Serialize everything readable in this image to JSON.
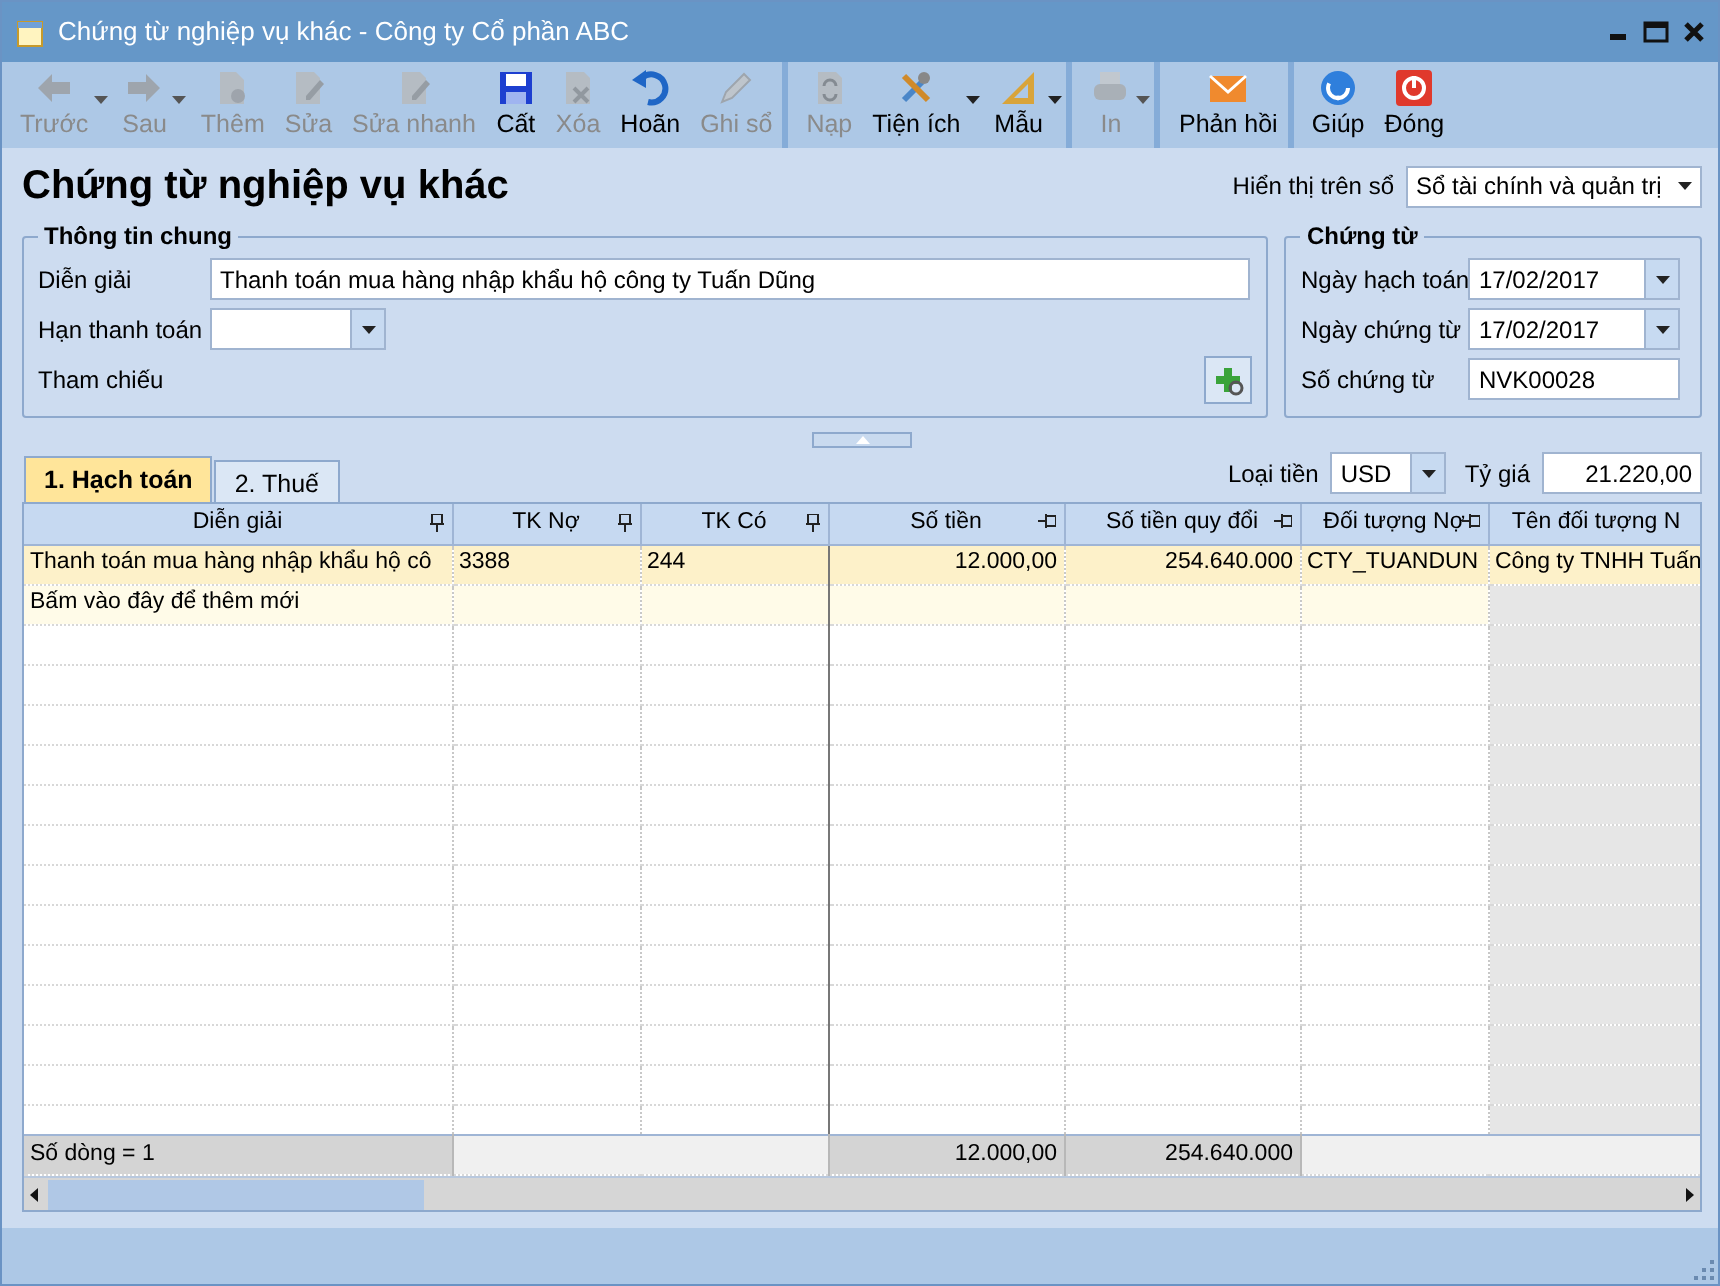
{
  "window": {
    "title": "Chứng từ nghiệp vụ khác - Công ty Cổ phần ABC"
  },
  "toolbar": {
    "buttons": [
      {
        "label": "Trước",
        "disabled": true,
        "dropdown": true,
        "separator_after": false
      },
      {
        "label": "Sau",
        "disabled": true,
        "dropdown": true,
        "separator_after": false
      },
      {
        "label": "Thêm",
        "disabled": true,
        "dropdown": false,
        "separator_after": false
      },
      {
        "label": "Sửa",
        "disabled": true,
        "dropdown": false,
        "separator_after": false
      },
      {
        "label": "Sửa nhanh",
        "disabled": true,
        "dropdown": false,
        "separator_after": false
      },
      {
        "label": "Cất",
        "disabled": false,
        "dropdown": false,
        "separator_after": false
      },
      {
        "label": "Xóa",
        "disabled": true,
        "dropdown": false,
        "separator_after": false
      },
      {
        "label": "Hoãn",
        "disabled": false,
        "dropdown": false,
        "separator_after": false
      },
      {
        "label": "Ghi sổ",
        "disabled": true,
        "dropdown": false,
        "separator_after": true
      },
      {
        "label": "Nạp",
        "disabled": true,
        "dropdown": false,
        "separator_after": false
      },
      {
        "label": "Tiện ích",
        "disabled": false,
        "dropdown": true,
        "separator_after": false
      },
      {
        "label": "Mẫu",
        "disabled": false,
        "dropdown": true,
        "separator_after": true
      },
      {
        "label": "In",
        "disabled": true,
        "dropdown": true,
        "separator_after": true
      },
      {
        "label": "Phản hồi",
        "disabled": false,
        "dropdown": false,
        "separator_after": true
      },
      {
        "label": "Giúp",
        "disabled": false,
        "dropdown": false,
        "separator_after": false
      },
      {
        "label": "Đóng",
        "disabled": false,
        "dropdown": false,
        "separator_after": false
      }
    ]
  },
  "heading": "Chứng từ nghiệp vụ khác",
  "ledger": {
    "label": "Hiển thị trên sổ",
    "value": "Sổ tài chính và quản trị"
  },
  "general_info": {
    "title": "Thông tin chung",
    "fields": [
      {
        "label": "Diễn giải",
        "kind": "text",
        "value": "Thanh toán mua hàng nhập khẩu hộ công ty Tuấn Dũng"
      },
      {
        "label": "Hạn thanh toán",
        "kind": "combo"
      },
      {
        "label": "Tham chiếu",
        "kind": "lookup"
      }
    ]
  },
  "voucher": {
    "title": "Chứng từ",
    "fields": [
      {
        "label": "Ngày hạch toán",
        "kind": "combo",
        "value": "17/02/2017"
      },
      {
        "label": "Ngày chứng từ",
        "kind": "combo",
        "value": "17/02/2017"
      },
      {
        "label": "Số chứng từ",
        "kind": "text",
        "value": "NVK00028"
      }
    ]
  },
  "tabs": [
    {
      "label": "1. Hạch toán",
      "selected": true
    },
    {
      "label": "2. Thuế",
      "selected": false
    }
  ],
  "currency": {
    "label": "Loại tiền",
    "value": "USD"
  },
  "rate": {
    "label": "Tỷ giá",
    "value": "21.220,00"
  },
  "grid": {
    "columns": [
      {
        "label": "Diễn giải",
        "kind": "text"
      },
      {
        "label": "TK Nợ",
        "kind": "text"
      },
      {
        "label": "TK Có",
        "kind": "text"
      },
      {
        "label": "Số tiền",
        "kind": "amount"
      },
      {
        "label": "Số tiền quy đổi",
        "kind": "amount"
      },
      {
        "label": "Đối tượng Nợ",
        "kind": "text"
      },
      {
        "label": "Tên đối tượng N",
        "kind": "text"
      }
    ],
    "rows": [
      {
        "selected": true,
        "cells": [
          "Thanh toán mua hàng nhập khẩu hộ cô",
          "3388",
          "244",
          "12.000,00",
          "254.640.000",
          "CTY_TUANDUN",
          "Công ty TNHH Tuấn"
        ]
      }
    ],
    "new_row_hint": "Bấm vào đây để thêm mới",
    "footer": {
      "row_count": "Số dòng = 1",
      "amount_total": "12.000,00",
      "converted_total": "254.640.000"
    }
  }
}
